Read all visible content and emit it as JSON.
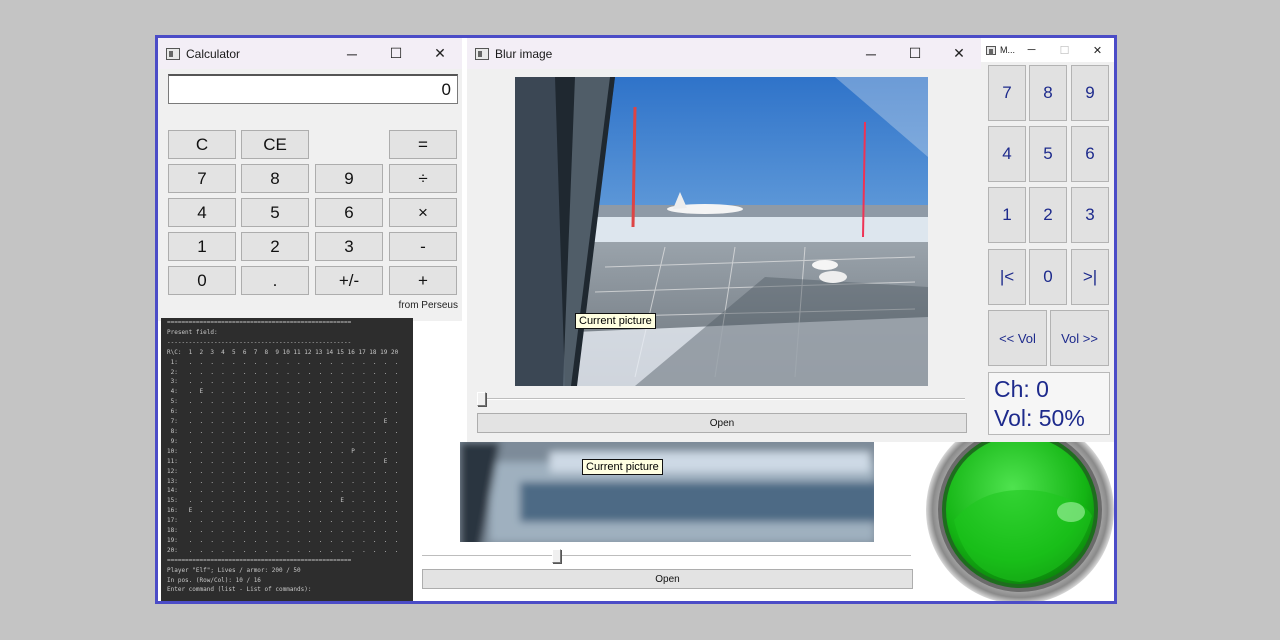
{
  "calculator": {
    "title": "Calculator",
    "display": "0",
    "buttons": [
      "C",
      "CE",
      "=",
      "7",
      "8",
      "9",
      "÷",
      "4",
      "5",
      "6",
      "×",
      "1",
      "2",
      "3",
      "-",
      "0",
      ".",
      "+/-",
      "+"
    ],
    "credit": "from Perseus"
  },
  "window_controls": {
    "minimize": "─",
    "maximize": "☐",
    "close": "✕"
  },
  "console": {
    "lines": [
      "===================================================",
      "Present field:",
      "---------------------------------------------------",
      "R\\C:  1  2  3  4  5  6  7  8  9 10 11 12 13 14 15 16 17 18 19 20",
      " 1:   .  .  .  .  .  .  .  .  .  .  .  .  .  .  .  .  .  .  .  .",
      " 2:   .  .  .  .  .  .  .  .  .  .  .  .  .  .  .  .  .  .  .  .",
      " 3:   .  .  .  .  .  .  .  .  .  .  .  .  .  .  .  .  .  .  .  .",
      " 4:   .  E  .  .  .  .  .  .  .  .  .  .  .  .  .  .  .  .  .  .",
      " 5:   .  .  .  .  .  .  .  .  .  .  .  .  .  .  .  .  .  .  .  .",
      " 6:   .  .  .  .  .  .  .  .  .  .  .  .  .  .  .  .  .  .  .  .",
      " 7:   .  .  .  .  .  .  .  .  .  .  .  .  .  .  .  .  .  .  E  .",
      " 8:   .  .  .  .  .  .  .  .  .  .  .  .  .  .  .  .  .  .  .  .",
      " 9:   .  .  .  .  .  .  .  .  .  .  .  .  .  .  .  .  .  .  .  .",
      "10:   .  .  .  .  .  .  .  .  .  .  .  .  .  .  .  P  .  .  .  .",
      "11:   .  .  .  .  .  .  .  .  .  .  .  .  .  .  .  .  .  .  E  .",
      "12:   .  .  .  .  .  .  .  .  .  .  .  .  .  .  .  .  .  .  .  .",
      "13:   .  .  .  .  .  .  .  .  .  .  .  .  .  .  .  .  .  .  .  .",
      "14:   .  .  .  .  .  .  .  .  .  .  .  .  .  .  .  .  .  .  .  .",
      "15:   .  .  .  .  .  .  .  .  .  .  .  .  .  .  E  .  .  .  .  .",
      "16:   E  .  .  .  .  .  .  .  .  .  .  .  .  .  .  .  .  .  .  .",
      "17:   .  .  .  .  .  .  .  .  .  .  .  .  .  .  .  .  .  .  .  .",
      "18:   .  .  .  .  .  .  .  .  .  .  .  .  .  .  .  .  .  .  .  .",
      "19:   .  .  .  .  .  .  .  .  .  .  .  .  .  .  .  .  .  .  .  .",
      "20:   .  .  .  .  .  .  .  .  .  .  .  .  .  .  .  .  .  .  .  .",
      "===================================================",
      "Player \"Elf\"; Lives / armor: 200 / 50",
      "In pos. (Row/Col): 10 / 16",
      "Enter command (list - List of commands):"
    ]
  },
  "blur": {
    "title": "Blur image",
    "tooltip": "Current picture",
    "open_label": "Open",
    "slider_value": 0
  },
  "blur2": {
    "tooltip": "Current picture",
    "open_label": "Open",
    "slider_value": 0.27
  },
  "media": {
    "title": "M...",
    "buttons": [
      "7",
      "8",
      "9",
      "4",
      "5",
      "6",
      "1",
      "2",
      "3",
      "|<",
      "0",
      ">|"
    ],
    "vol_down": "<< Vol",
    "vol_up": "Vol >>",
    "channel": "Ch: 0",
    "volume": "Vol: 50%"
  },
  "colors": {
    "frame": "#4b4cc7",
    "media_text": "#1d2a8c",
    "green_button": "#1fbf1f"
  }
}
